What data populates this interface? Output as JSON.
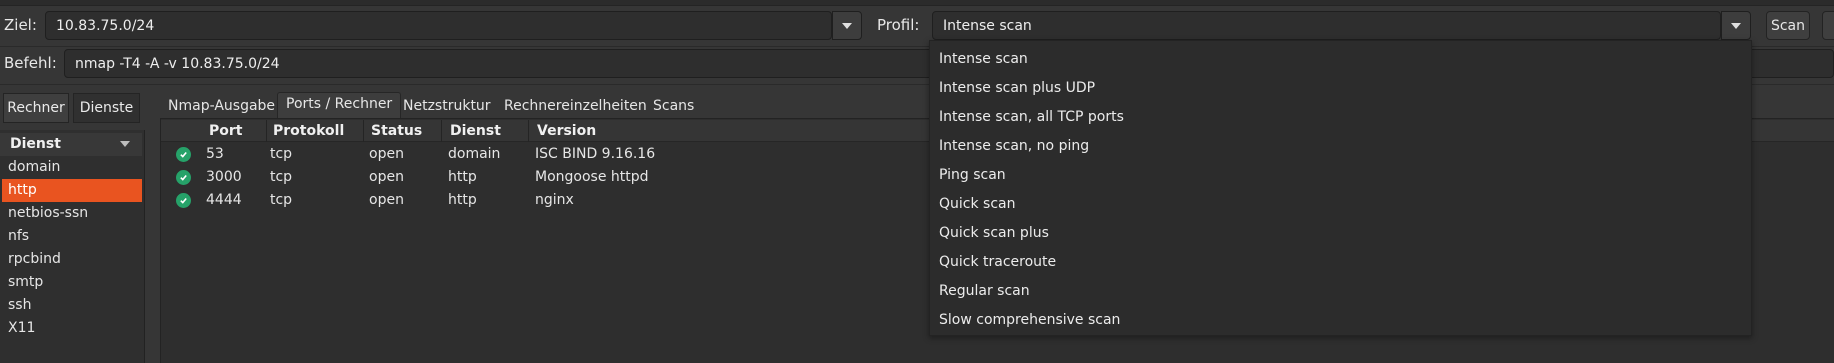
{
  "target": {
    "label": "Ziel:",
    "value": "10.83.75.0/24"
  },
  "profile": {
    "label": "Profil:",
    "value": "Intense scan"
  },
  "scan_button": "Scan",
  "command": {
    "label": "Befehl:",
    "value": "nmap -T4 -A -v 10.83.75.0/24"
  },
  "side_tabs": [
    "Rechner",
    "Dienste"
  ],
  "services": {
    "header": "Dienst",
    "items": [
      "domain",
      "http",
      "netbios-ssn",
      "nfs",
      "rpcbind",
      "smtp",
      "ssh",
      "X11"
    ],
    "selected": "http"
  },
  "tabs": [
    "Nmap-Ausgabe",
    "Ports / Rechner",
    "Netzstruktur",
    "Rechnereinzelheiten",
    "Scans"
  ],
  "active_tab": "Ports / Rechner",
  "ports_table": {
    "columns": [
      "Port",
      "Protokoll",
      "Status",
      "Dienst",
      "Version"
    ],
    "rows": [
      [
        "53",
        "tcp",
        "open",
        "domain",
        "ISC BIND 9.16.16"
      ],
      [
        "3000",
        "tcp",
        "open",
        "http",
        "Mongoose httpd"
      ],
      [
        "4444",
        "tcp",
        "open",
        "http",
        "nginx"
      ]
    ]
  },
  "profile_options": [
    "Intense scan",
    "Intense scan plus UDP",
    "Intense scan, all TCP ports",
    "Intense scan, no ping",
    "Ping scan",
    "Quick scan",
    "Quick scan plus",
    "Quick traceroute",
    "Regular scan",
    "Slow comprehensive scan"
  ],
  "colors": {
    "accent": "#e95420",
    "status_ok": "#26a269"
  },
  "icons": {
    "status": "check-circle-icon",
    "dropdown": "chevron-down-icon"
  }
}
